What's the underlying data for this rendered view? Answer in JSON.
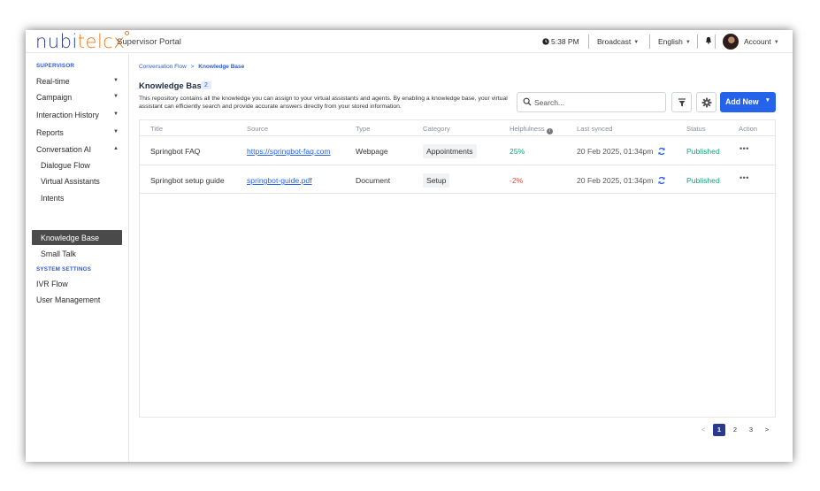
{
  "header": {
    "logo_part1": "nubi",
    "logo_part2": "telcx",
    "portal_title": "Supervisor Portal",
    "time": "5:38 PM",
    "broadcast_label": "Broadcast",
    "language": "English",
    "account_label": "Account"
  },
  "sidebar": {
    "section_supervisor": "SUPERVISOR",
    "items": [
      {
        "label": "Real-time"
      },
      {
        "label": "Campaign"
      },
      {
        "label": "Interaction History"
      },
      {
        "label": "Reports"
      },
      {
        "label": "Conversation AI"
      }
    ],
    "sub_items": [
      {
        "label": "Dialogue Flow"
      },
      {
        "label": "Virtual Assistants"
      },
      {
        "label": "Intents"
      },
      {
        "label": "Knowledge Base"
      },
      {
        "label": "Small Talk"
      }
    ],
    "section_system": "SYSTEM SETTINGS",
    "system_items": [
      {
        "label": "IVR Flow"
      },
      {
        "label": "User Management"
      }
    ]
  },
  "breadcrumb": {
    "parent": "Conversation Flow",
    "separator": ">",
    "current": "Knowledge Base"
  },
  "page": {
    "title": "Knowledge Base",
    "count": "2",
    "description": "This repository contains all the knowledge you can assign to your virtual assistants and agents. By enabling a knowledge base, your virtual assistant can efficiently search and provide accurate answers directly from your stored information."
  },
  "search": {
    "placeholder": "Search..."
  },
  "toolbar": {
    "add_new_label": "Add New"
  },
  "table": {
    "headers": {
      "title": "Title",
      "source": "Source",
      "type": "Type",
      "category": "Category",
      "helpfulness": "Helpfulness",
      "last_synced": "Last synced",
      "status": "Status",
      "action": "Action"
    },
    "rows": [
      {
        "title": "Springbot FAQ",
        "source": "https://springbot-faq.com",
        "type": "Webpage",
        "category": "Appointments",
        "helpfulness": "25%",
        "last_synced": "20 Feb 2025, 01:34pm",
        "status": "Published",
        "action": "•••"
      },
      {
        "title": "Springbot setup guide",
        "source": "springbot-guide.pdf",
        "type": "Document",
        "category": "Setup",
        "helpfulness": "-2%",
        "last_synced": "20 Feb 2025, 01:34pm",
        "status": "Published",
        "action": "•••"
      }
    ]
  },
  "pagination": {
    "prev": "<",
    "pages": [
      "1",
      "2",
      "3"
    ],
    "current": "1",
    "next": ">"
  },
  "colors": {
    "accent": "#2563eb",
    "brand_blue": "#2a3b8f",
    "brand_orange": "#ea7b1f",
    "positive": "#16a37c",
    "negative": "#e15241"
  }
}
